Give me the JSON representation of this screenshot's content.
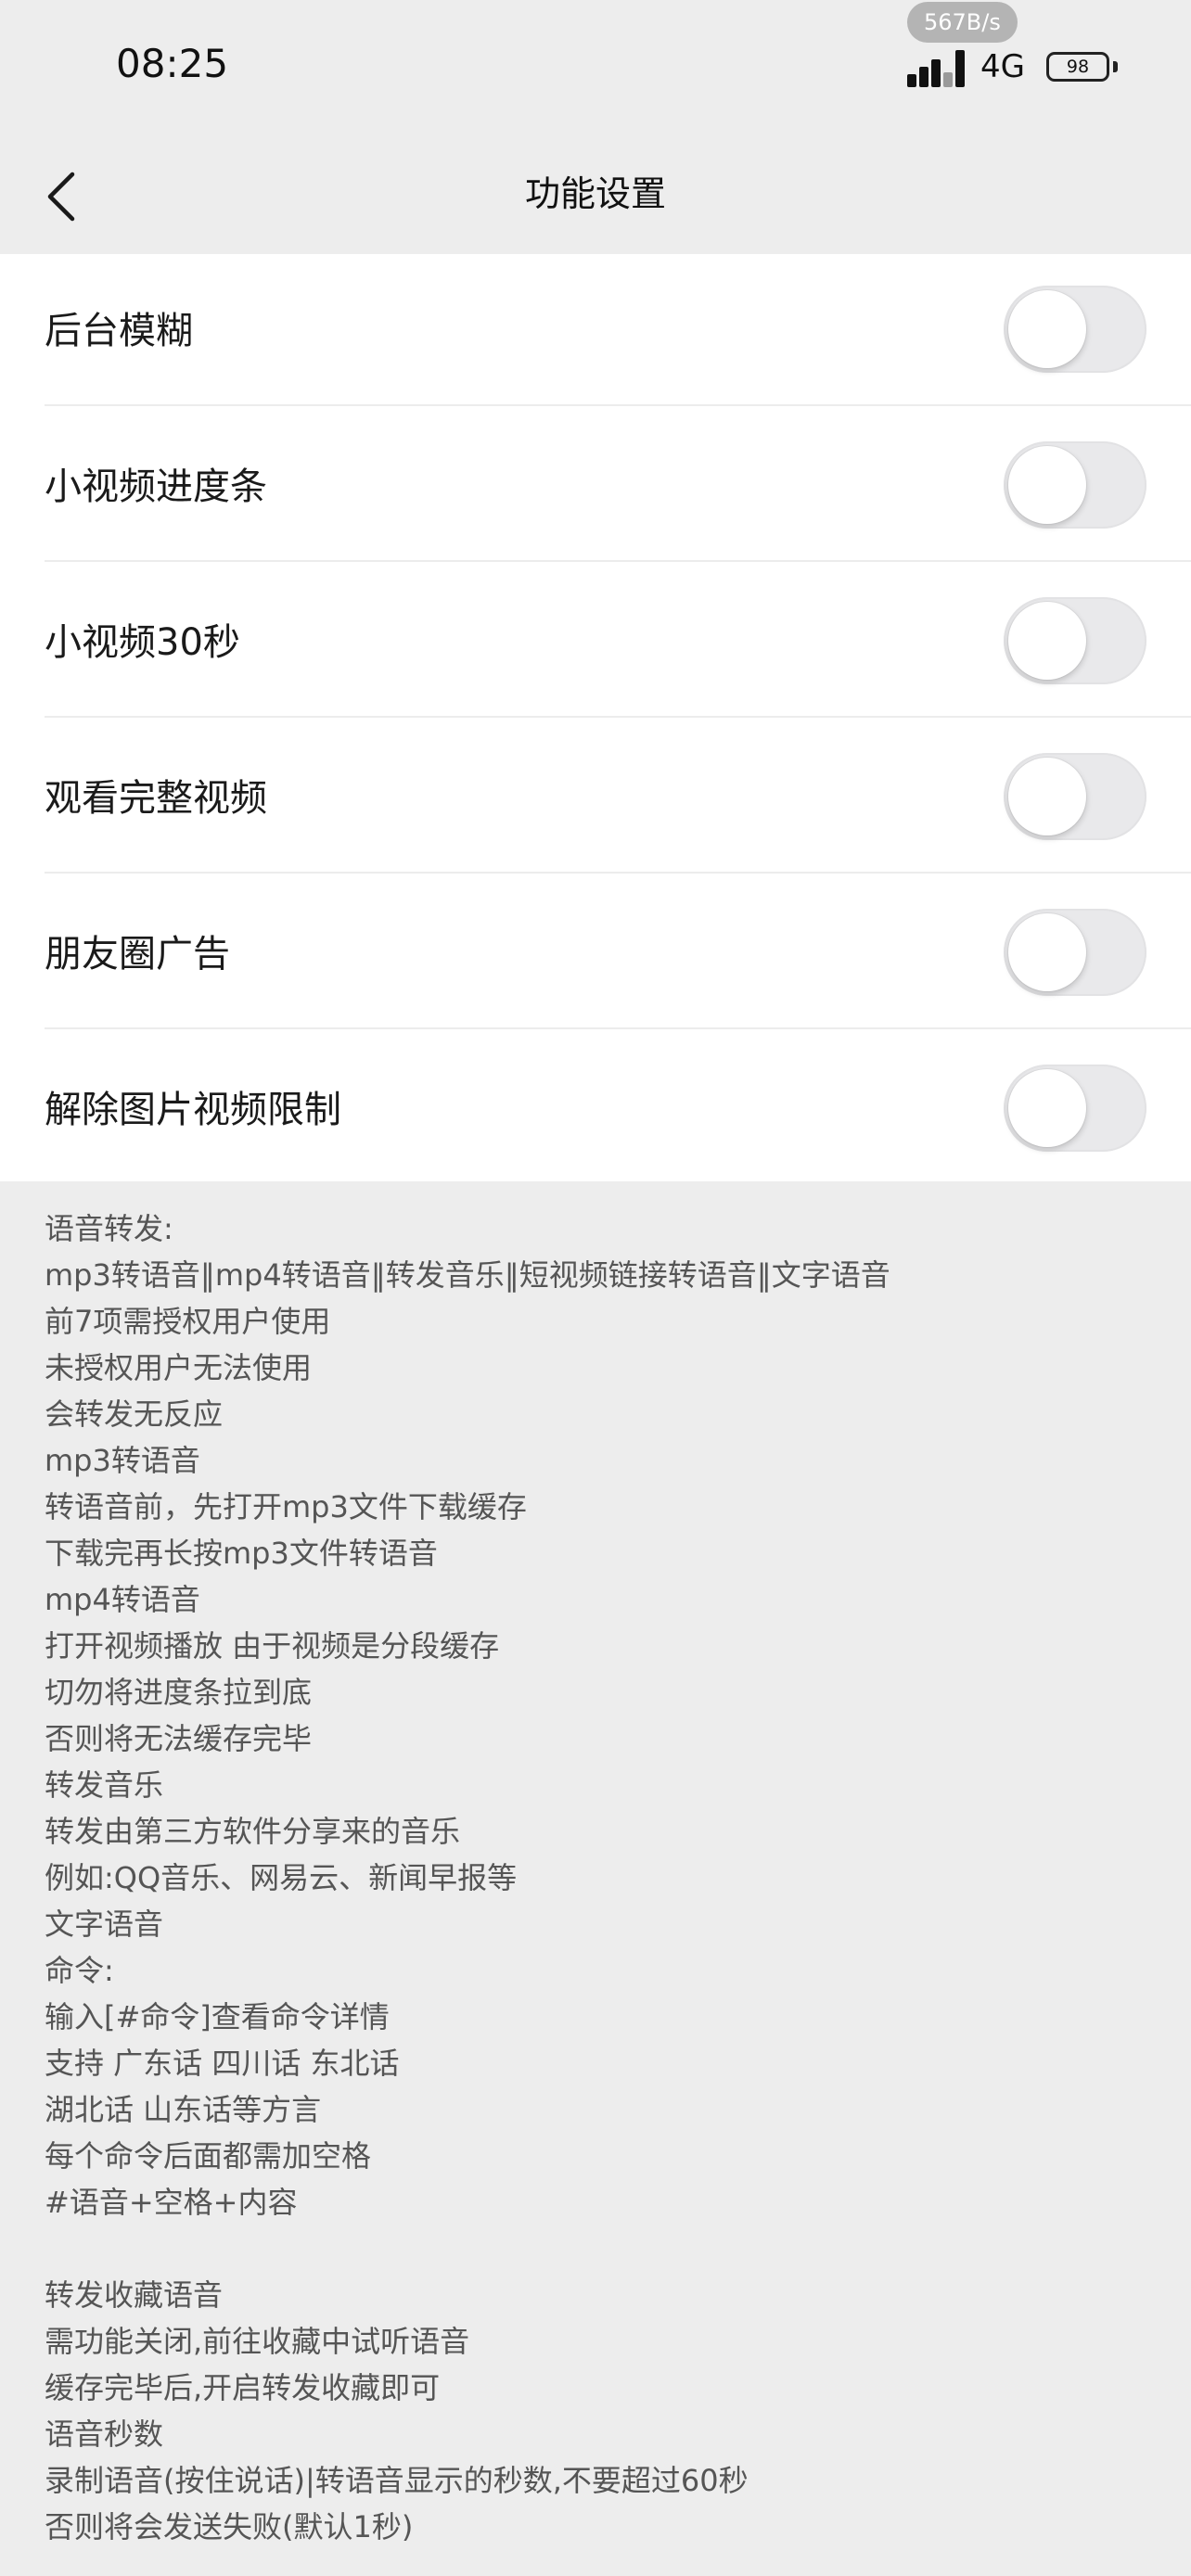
{
  "status_bar": {
    "time": "08:25",
    "net_speed": "567B/s",
    "net_type": "4G",
    "battery": "98"
  },
  "nav": {
    "title": "功能设置"
  },
  "settings": [
    {
      "label": "后台模糊",
      "enabled": false
    },
    {
      "label": "小视频进度条",
      "enabled": false
    },
    {
      "label": "小视频30秒",
      "enabled": false
    },
    {
      "label": "观看完整视频",
      "enabled": false
    },
    {
      "label": "朋友圈广告",
      "enabled": false
    },
    {
      "label": "解除图片视频限制",
      "enabled": false
    }
  ],
  "help_lines": [
    "语音转发:",
    "mp3转语音‖mp4转语音‖转发音乐‖短视频链接转语音‖文字语音",
    "前7项需授权用户使用",
    "未授权用户无法使用",
    "会转发无反应",
    "mp3转语音",
    "转语音前，先打开mp3文件下载缓存",
    "下载完再长按mp3文件转语音",
    "mp4转语音",
    "打开视频播放 由于视频是分段缓存",
    "切勿将进度条拉到底",
    "否则将无法缓存完毕",
    "转发音乐",
    "转发由第三方软件分享来的音乐",
    "例如:QQ音乐、网易云、新闻早报等",
    "文字语音",
    "命令:",
    "输入[#命令]查看命令详情",
    "支持 广东话 四川话 东北话",
    "湖北话 山东话等方言",
    "每个命令后面都需加空格",
    "#语音+空格+内容",
    "",
    "转发收藏语音",
    "需功能关闭,前往收藏中试听语音",
    "缓存完毕后,开启转发收藏即可",
    "语音秒数",
    "录制语音(按住说话)|转语音显示的秒数,不要超过60秒",
    "否则将会发送失败(默认1秒)"
  ],
  "colors": {
    "page_background": "#ededed",
    "list_background": "#ffffff",
    "toggle_off": "#e9e9eb",
    "help_text": "#555555"
  }
}
